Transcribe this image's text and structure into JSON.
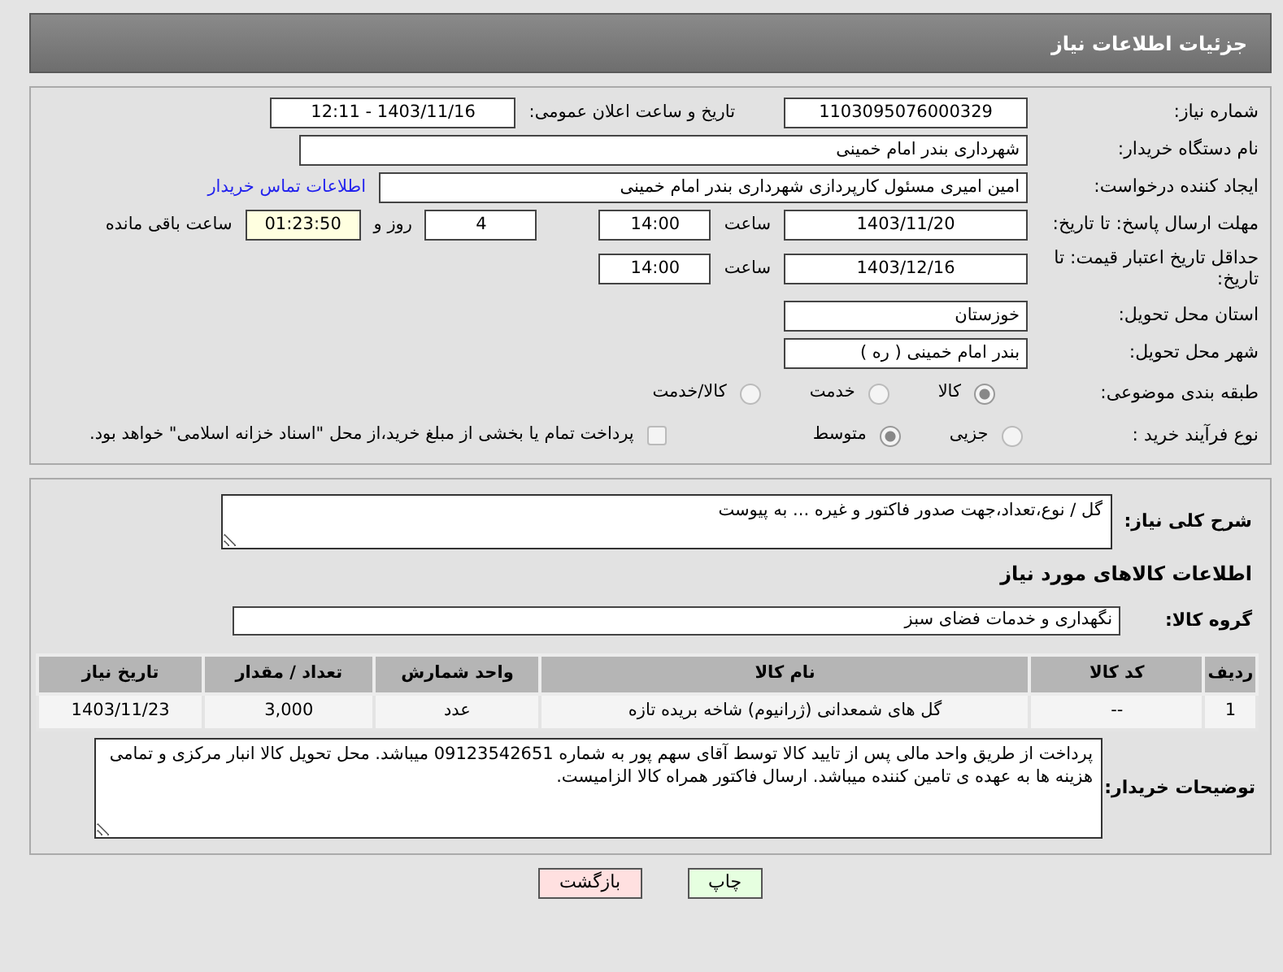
{
  "header": {
    "title": "جزئیات اطلاعات نیاز"
  },
  "need_number": {
    "label": "شماره نیاز:",
    "value": "1103095076000329"
  },
  "announce": {
    "label": "تاریخ و ساعت اعلان عمومی:",
    "value": "1403/11/16 - 12:11"
  },
  "buyer_org": {
    "label": "نام دستگاه خریدار:",
    "value": "شهرداری بندر امام خمینی"
  },
  "requester": {
    "label": "ایجاد کننده درخواست:",
    "value": "امین امیری مسئول کارپردازی شهرداری بندر امام خمینی",
    "link": "اطلاعات تماس خریدار"
  },
  "reply_deadline": {
    "label": "مهلت ارسال پاسخ: تا تاریخ:",
    "date": "1403/11/20",
    "time_label": "ساعت",
    "time": "14:00",
    "days": "4",
    "days_label": "روز و",
    "remaining": "01:23:50",
    "remaining_label": "ساعت باقی مانده"
  },
  "price_validity": {
    "label": "حداقل تاریخ اعتبار قیمت: تا تاریخ:",
    "date": "1403/12/16",
    "time_label": "ساعت",
    "time": "14:00"
  },
  "province": {
    "label": "استان محل تحویل:",
    "value": "خوزستان"
  },
  "city": {
    "label": "شهر محل تحویل:",
    "value": "بندر امام خمینی ( ره )"
  },
  "category": {
    "label": "طبقه بندی موضوعی:",
    "options": [
      {
        "label": "کالا",
        "selected": true
      },
      {
        "label": "خدمت",
        "selected": false
      },
      {
        "label": "کالا/خدمت",
        "selected": false
      }
    ]
  },
  "process": {
    "label": "نوع فرآیند خرید :",
    "options": [
      {
        "label": "جزیی",
        "selected": false
      },
      {
        "label": "متوسط",
        "selected": true
      }
    ],
    "payment": {
      "checked": false,
      "text": "پرداخت تمام یا بخشی از مبلغ خرید،از محل \"اسناد خزانه اسلامی\" خواهد بود."
    }
  },
  "description": {
    "label": "شرح کلی نیاز:",
    "value": "گل / نوع،تعداد،جهت صدور فاکتور و غیره ... به پیوست"
  },
  "goods_heading": "اطلاعات کالاهای مورد نیاز",
  "goods_group": {
    "label": "گروه کالا:",
    "value": "نگهداری و خدمات فضای سبز"
  },
  "table": {
    "columns": [
      "ردیف",
      "کد کالا",
      "نام کالا",
      "واحد شمارش",
      "تعداد / مقدار",
      "تاریخ نیاز"
    ],
    "rows": [
      [
        "1",
        "--",
        "گل های شمعدانی (ژرانیوم) شاخه بریده تازه",
        "عدد",
        "3,000",
        "1403/11/23"
      ]
    ]
  },
  "buyer_notes": {
    "label": "توضیحات خریدار:",
    "value": "پرداخت از طریق واحد مالی پس از تایید کالا توسط آقای سهم پور به شماره 09123542651 میباشد. محل تحویل کالا انبار مرکزی و تمامی هزینه ها به عهده ی تامین کننده میباشد. ارسال فاکتور همراه کالا الزامیست."
  },
  "buttons": [
    {
      "label": "چاپ",
      "kind": "print"
    },
    {
      "label": "بازگشت",
      "kind": "back"
    }
  ]
}
